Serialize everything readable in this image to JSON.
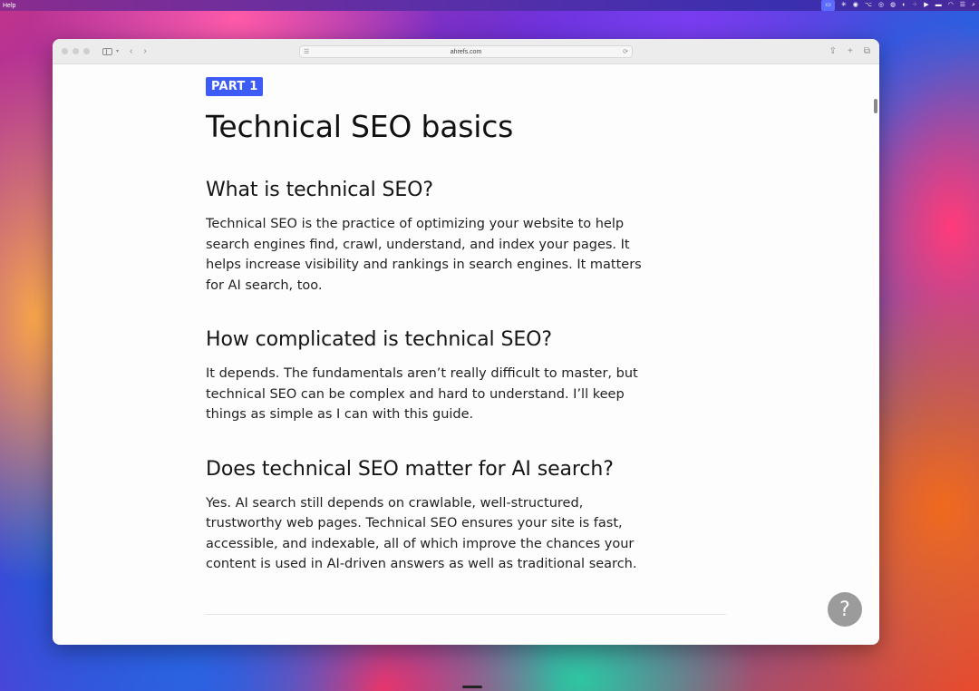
{
  "menubar": {
    "help_label": "Help",
    "status_icons": [
      "display-icon",
      "brightness-icon",
      "record-icon",
      "option-icon",
      "spiral-icon",
      "swirl-icon",
      "camera-icon",
      "grid-icon",
      "play-icon",
      "battery-icon",
      "wifi-icon",
      "menu-icon",
      "search-icon"
    ]
  },
  "browser": {
    "url": "ahrefs.com"
  },
  "article": {
    "part_label": "PART 1",
    "title": "Technical SEO basics",
    "sections": [
      {
        "heading": "What is technical SEO?",
        "body": "Technical SEO is the practice of optimizing your website to help search engines find, crawl, understand, and index your pages. It helps increase visibility and rankings in search engines. It matters for AI search, too."
      },
      {
        "heading": "How complicated is technical SEO?",
        "body": "It depends. The fundamentals aren’t really difficult to master, but technical SEO can be complex and hard to understand. I’ll keep things as simple as I can with this guide."
      },
      {
        "heading": "Does technical SEO matter for AI search?",
        "body": "Yes. AI search still depends on crawlable, well-structured, trustworthy web pages. Technical SEO ensures your site is fast, accessible, and indexable, all of which improve the chances your content is used in AI-driven answers as well as traditional search."
      }
    ]
  },
  "help_button": {
    "label": "?"
  },
  "colors": {
    "badge": "#3d5bf6",
    "help_button": "#9b9b9b"
  }
}
